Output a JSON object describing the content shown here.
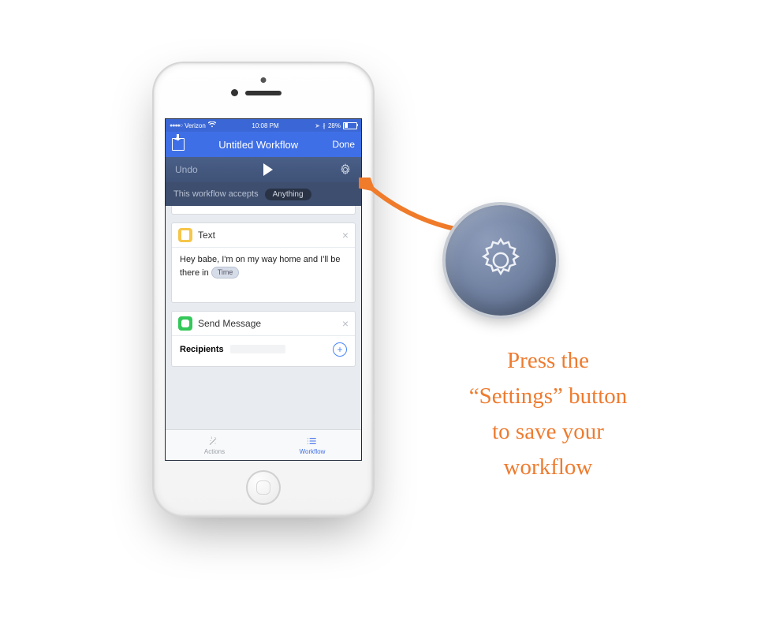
{
  "statusbar": {
    "carrier": "Verizon",
    "time": "10:08 PM",
    "battery_pct": "28%"
  },
  "nav": {
    "title": "Untitled Workflow",
    "done_label": "Done"
  },
  "toolbar": {
    "undo_label": "Undo"
  },
  "accepts": {
    "prefix": "This workflow accepts",
    "value": "Anything"
  },
  "cards": {
    "text": {
      "title": "Text",
      "body_prefix": "Hey babe, I'm on my way home and I'll be there in",
      "token": "Time"
    },
    "message": {
      "title": "Send Message",
      "recipients_label": "Recipients"
    }
  },
  "tabs": {
    "actions": "Actions",
    "workflow": "Workflow"
  },
  "callout": {
    "line1": "Press the",
    "line2": "“Settings” button",
    "line3": "to save your",
    "line4": "workflow"
  }
}
